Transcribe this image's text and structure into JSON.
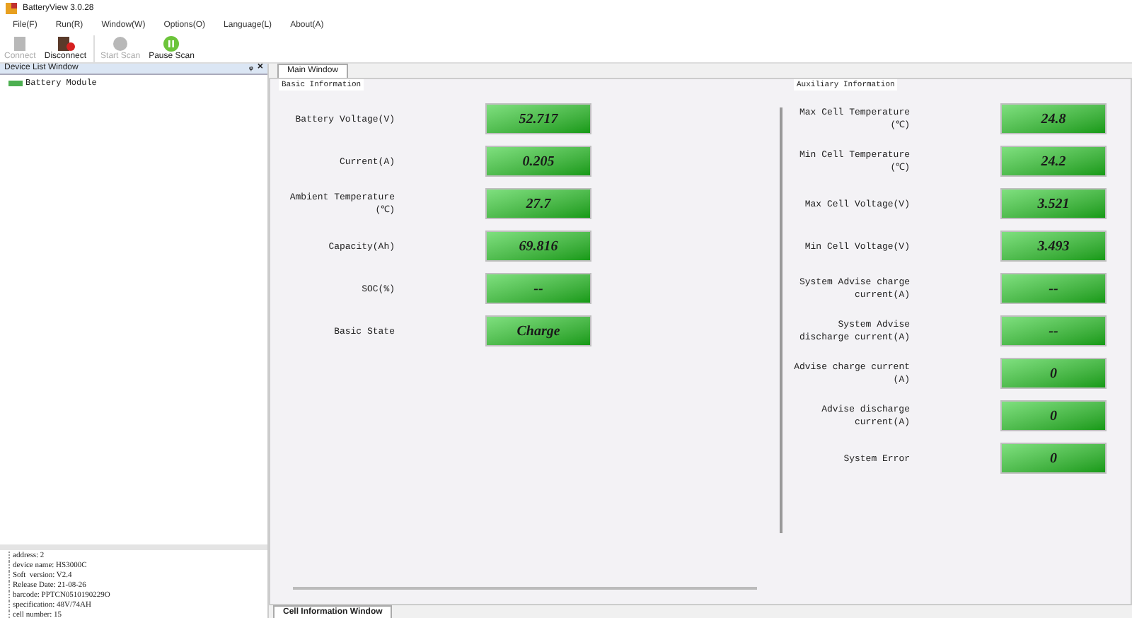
{
  "window": {
    "title": "BatteryView 3.0.28"
  },
  "menu": [
    "File(F)",
    "Run(R)",
    "Window(W)",
    "Options(O)",
    "Language(L)",
    "About(A)"
  ],
  "toolbar": [
    {
      "label": "Connect",
      "kind": "connect",
      "disabled": true
    },
    {
      "label": "Disconnect",
      "kind": "disconnect",
      "disabled": false
    },
    {
      "label": "Start Scan",
      "kind": "start",
      "disabled": true
    },
    {
      "label": "Pause Scan",
      "kind": "pause",
      "disabled": false
    }
  ],
  "device_list": {
    "title": "Device List Window",
    "pin": "ᵩ",
    "close": "×",
    "items": [
      "Battery Module"
    ]
  },
  "device_info": [
    "address: 2",
    "device name: HS3000C",
    "Soft  version: V2.4",
    "Release Date: 21-08-26",
    "barcode: PPTCN0510190229O",
    "specification: 48V/74AH",
    "cell number: 15"
  ],
  "main_tab": {
    "label": "Main Window",
    "selected": true
  },
  "basic": {
    "title": "Basic Information",
    "rows": [
      {
        "label": "Battery Voltage(V)",
        "value": "52.717"
      },
      {
        "label": "Current(A)",
        "value": "0.205"
      },
      {
        "label": "Ambient Temperature\n(℃)",
        "value": "27.7"
      },
      {
        "label": "Capacity(Ah)",
        "value": "69.816"
      },
      {
        "label": "SOC(%)",
        "value": "--"
      },
      {
        "label": "Basic State",
        "value": "Charge"
      }
    ]
  },
  "auxiliary": {
    "title": "Auxiliary Information",
    "rows": [
      {
        "label": "Max Cell Temperature\n(℃)",
        "value": "24.8"
      },
      {
        "label": "Min Cell Temperature\n(℃)",
        "value": "24.2"
      },
      {
        "label": "Max Cell Voltage(V)",
        "value": "3.521"
      },
      {
        "label": "Min Cell Voltage(V)",
        "value": "3.493"
      },
      {
        "label": "System Advise charge\ncurrent(A)",
        "value": "--"
      },
      {
        "label": "System Advise\ndischarge current(A)",
        "value": "--"
      },
      {
        "label": "Advise charge current\n(A)",
        "value": "0"
      },
      {
        "label": "Advise discharge\ncurrent(A)",
        "value": "0"
      },
      {
        "label": "System Error",
        "value": "0"
      }
    ]
  },
  "bottom_tab": {
    "label": "Cell Information Window",
    "selected": true
  }
}
